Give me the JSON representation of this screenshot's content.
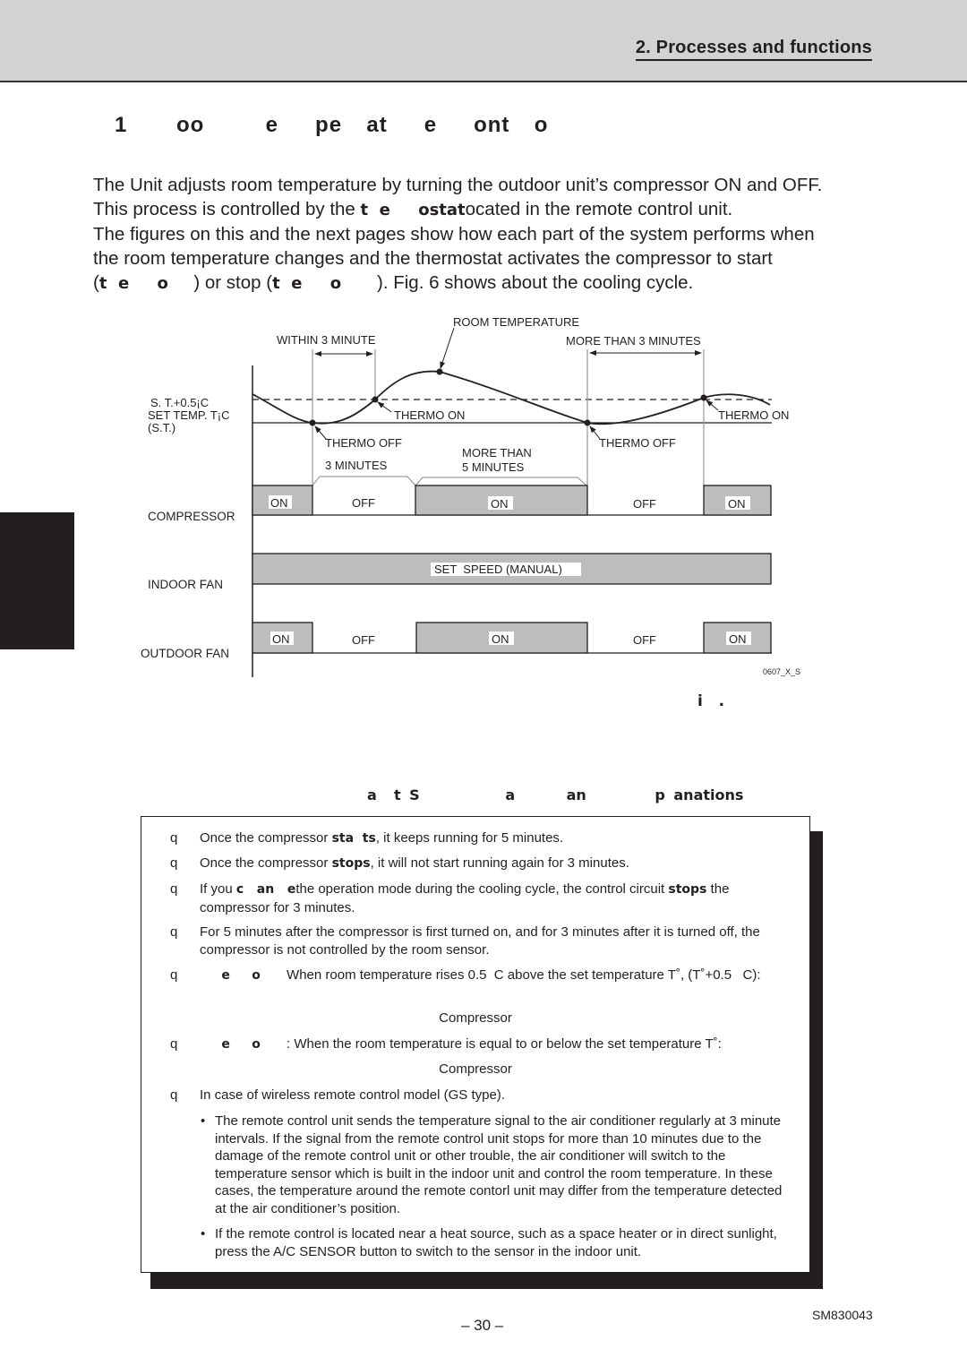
{
  "header": {
    "section_title": "2. Processes and functions"
  },
  "heading": "1    oo     e   pe  at   e   ont  o",
  "intro": {
    "line1": "The Unit adjusts room temperature by turning the outdoor unit’s compressor ON and OFF.",
    "line2_pre": "This process is controlled by the ",
    "line2_bold": "t  e     ostat",
    "line2_post": "ocated in the remote control unit.",
    "line3": "The figures on this and the next pages show how each part of the system performs when",
    "line4": "the room temperature changes and the thermostat activates the compressor to start",
    "line5_open": "(",
    "line5_bold1": "t  e     o",
    "line5_mid": "     ) or stop (",
    "line5_bold2": "t  e     o",
    "line5_post": "       ). Fig. 6 shows about the cooling cycle."
  },
  "diagram": {
    "room_temperature_label": "ROOM TEMPERATURE",
    "within_label": "WITHIN 3 MINUTE",
    "more_than_3_label": "MORE THAN 3 MINUTES",
    "st_plus_label": "S. T.+0.5¡C",
    "set_temp_label": "SET TEMP. T¡C",
    "st_label": "(S.T.)",
    "thermo_on_1": "THERMO ON",
    "thermo_on_2": "THERMO ON",
    "thermo_off_1": "THERMO OFF",
    "thermo_off_2": "THERMO OFF",
    "three_minutes": "3 MINUTES",
    "more_than": "MORE THAN",
    "five_minutes": "5 MINUTES",
    "rows": {
      "compressor": {
        "label": "COMPRESSOR",
        "states": [
          "ON",
          "OFF",
          "ON",
          "OFF",
          "ON"
        ]
      },
      "indoor_fan": {
        "label": "INDOOR FAN",
        "states": [
          "SET  SPEED (MANUAL)"
        ]
      },
      "outdoor_fan": {
        "label": "OUTDOOR FAN",
        "states": [
          "ON",
          "OFF",
          "ON",
          "OFF",
          "ON"
        ]
      }
    },
    "figure_code": "0607_X_S",
    "fill_color": "#bcbdbf"
  },
  "figure_caption": "i   .",
  "box": {
    "title": "a  t S          a      an        p anations",
    "items": [
      {
        "pre": "Once the compressor ",
        "bold": "sta  ts",
        "post": ", it keeps running for 5 minutes."
      },
      {
        "pre": "Once the compressor ",
        "bold": "stops",
        "post": ", it will not start running again for 3 minutes."
      },
      {
        "pre": "If you ",
        "bold": "c   an   e",
        "post": "the operation mode during the cooling cycle, the control circuit ",
        "bold2": "stops",
        "post2": " the compressor for 3 minutes."
      },
      {
        "pre": "For 5 minutes after the compressor is first turned on, and for 3 minutes after it is turned off, the compressor is not controlled by the room sensor."
      },
      {
        "bold": "     e     o",
        "post": "       When room temperature rises 0.5  C above the set temperature T˚, (T˚+0.5   C):"
      },
      {
        "bold": "     e     o",
        "post": "       : When the room temperature is equal to or below the set temperature T˚:"
      },
      {
        "pre": "In case of wireless remote control model (GS type)."
      }
    ],
    "compressor_label_1": "Compressor",
    "compressor_label_2": "Compressor",
    "bullet_marker": "q",
    "bullets": [
      "The remote control unit sends the temperature signal to the air conditioner regularly at 3 minute intervals. If the signal from the remote control unit stops for more than 10 minutes due to the damage of the remote control unit or other trouble, the air conditioner will switch to the temperature sensor which is built in the indoor unit and control the room temperature. In these cases, the temperature around the remote contorl unit may differ from the temperature detected at the air conditioner’s position.",
      "If the remote control is located near a heat source, such as a space heater or in direct sunlight, press the A/C SENSOR button to switch to the sensor in the indoor unit."
    ],
    "dot": "•"
  },
  "footer": {
    "page_number": "– 30 –",
    "doc_code": "SM830043"
  }
}
